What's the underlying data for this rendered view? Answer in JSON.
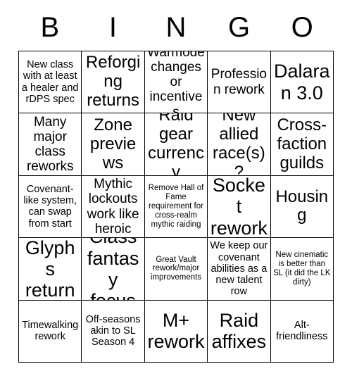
{
  "card": {
    "title": "BINGO",
    "header_letters": [
      "B",
      "I",
      "N",
      "G",
      "O"
    ],
    "background_color": "#ffffff",
    "text_color": "#000000",
    "border_color": "#000000",
    "rows": 5,
    "columns": 5
  },
  "cells": [
    {
      "text": "New class with at least a healer and rDPS spec",
      "size": "sm"
    },
    {
      "text": "Reforging returns",
      "size": "lg"
    },
    {
      "text": "Warmode changes or incentives",
      "size": "md"
    },
    {
      "text": "Profession rework",
      "size": "md"
    },
    {
      "text": "Dalaran 3.0",
      "size": "xl"
    },
    {
      "text": "Many major class reworks",
      "size": "md"
    },
    {
      "text": "Zone previews",
      "size": "lg"
    },
    {
      "text": "Raid gear currency",
      "size": "lg"
    },
    {
      "text": "New allied race(s)?",
      "size": "lg"
    },
    {
      "text": "Cross-faction guilds",
      "size": "lg"
    },
    {
      "text": "Covenant-like system, can swap from start",
      "size": "sm"
    },
    {
      "text": "Mythic lockouts work like heroic",
      "size": "md"
    },
    {
      "text": "Remove Hall of Fame requirement for cross-realm mythic raiding",
      "size": "xs"
    },
    {
      "text": "Socket rework",
      "size": "xl"
    },
    {
      "text": "Housing",
      "size": "lg"
    },
    {
      "text": "Glyphs return",
      "size": "xl"
    },
    {
      "text": "Class fantasy focus",
      "size": "xl"
    },
    {
      "text": "Great Vault rework/major improvements",
      "size": "xs"
    },
    {
      "text": "We keep our covenant abilities as a new talent row",
      "size": "sm"
    },
    {
      "text": "New cinematic is better than SL (it did the LK dirty)",
      "size": "xs"
    },
    {
      "text": "Timewalking rework",
      "size": "sm"
    },
    {
      "text": "Off-seasons akin to SL Season 4",
      "size": "sm"
    },
    {
      "text": "M+ rework",
      "size": "xl"
    },
    {
      "text": "Raid affixes",
      "size": "xl"
    },
    {
      "text": "Alt-friendliness",
      "size": "sm"
    }
  ]
}
